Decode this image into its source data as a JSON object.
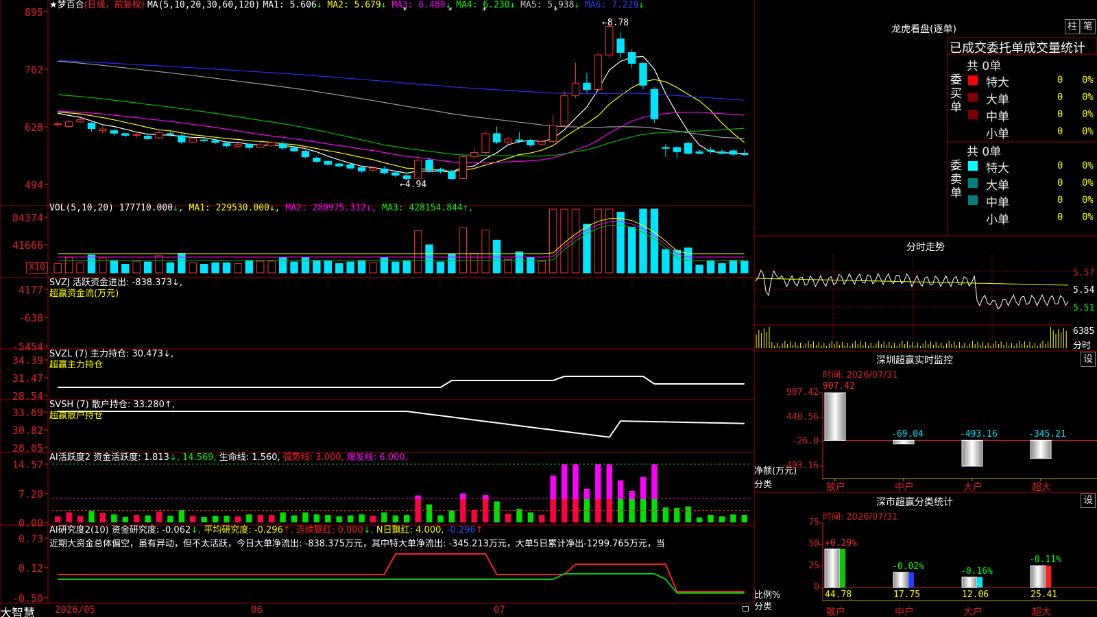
{
  "stock_title": "★梦百合",
  "period": "(日线，前复权)",
  "ma_header": {
    "label": "MA(5,10,20,30,60,120)",
    "items": [
      {
        "name": "MA1:",
        "value": "5.606",
        "arrow": "↓",
        "color": "#ffffff"
      },
      {
        "name": "MA2:",
        "value": "5.679",
        "arrow": "↓",
        "color": "#ffff00"
      },
      {
        "name": "MA3:",
        "value": "6.480",
        "arrow": "↓",
        "color": "#ff00ff"
      },
      {
        "name": "MA4:",
        "value": "6.230",
        "arrow": "↓",
        "color": "#00ff00"
      },
      {
        "name": "MA5:",
        "value": "5.938",
        "arrow": "↓",
        "color": "#c0c0c0"
      },
      {
        "name": "MA6:",
        "value": "7.229",
        "arrow": "↓",
        "color": "#2d43ff"
      }
    ]
  },
  "price_axis": [
    "895",
    "762",
    "628",
    "494"
  ],
  "price_max_label": "←8.78",
  "price_min_label": "←4.94",
  "vol_header": {
    "label": "VOL(5,10,20)",
    "value": "177710.000",
    "arrow": "↓",
    "items": [
      {
        "name": "MA1:",
        "value": "229530.000",
        "arrow": "↓",
        "color": "#ffff00"
      },
      {
        "name": "MA2:",
        "value": "280975.312",
        "arrow": "↓",
        "color": "#ff00ff"
      },
      {
        "name": "MA3:",
        "value": "428154.844",
        "arrow": "↑",
        "color": "#00ff00"
      }
    ]
  },
  "vol_axis": [
    "84374",
    "41666"
  ],
  "vol_unit": "X10",
  "svzj": {
    "line1": "SVZJ  活跃资金进出: -838.373↓,",
    "line2": "超赢资金流(万元)",
    "axis": [
      "4177",
      "-638",
      "-5454"
    ]
  },
  "svzl": {
    "line1": "SVZL (7) 主力持仓: 30.473↓,",
    "line2": "超赢主力持仓",
    "axis": [
      "34.39",
      "31.47",
      "28.54"
    ]
  },
  "svsh": {
    "line1": "SVSH (7) 散户持仓: 33.280↑,",
    "line2": "超赢散户持仓",
    "axis": [
      "33.69",
      "30.82",
      "28.05"
    ]
  },
  "ai1": {
    "items": [
      {
        "t": "AI活跃度2 资金活跃度: 1.813",
        "c": "#ffffff"
      },
      {
        "t": "↓, 14.569,",
        "c": "#00ff00"
      },
      {
        "t": " 生命线: 1.560,",
        "c": "#ffffff"
      },
      {
        "t": " 强势线: 3.000,",
        "c": "#ff2020"
      },
      {
        "t": " 爆发线: 6.000,",
        "c": "#ff00ff"
      }
    ],
    "axis": [
      "14.57",
      "7.20",
      "0.00"
    ]
  },
  "ai2": {
    "items": [
      {
        "t": "AI研究度2(10) 资金研究度: -0.062",
        "c": "#ffffff"
      },
      {
        "t": "↓, ",
        "c": "#00ff00"
      },
      {
        "t": "平均研究度: -0.296",
        "c": "#ffff00"
      },
      {
        "t": "↑, ",
        "c": "#ff2020"
      },
      {
        "t": "连续飘红: 0.000",
        "c": "#ff2020"
      },
      {
        "t": "↓, ",
        "c": "#00ff00"
      },
      {
        "t": "N日飘红: 4.000, ",
        "c": "#ffff00"
      },
      {
        "t": "-0.296",
        "c": "#3050ff"
      },
      {
        "t": "↑",
        "c": "#ff2020"
      }
    ],
    "comment": "近期大资金总体偏空，虽有异动，但不太活跃，今日大单净流出: -838.375万元，其中特大单净流出: -345.213万元，大单5日累计净出-1299.765万元，当",
    "axis": [
      "0.73",
      "0.12",
      "-0.50"
    ]
  },
  "bottom_bar": {
    "brand": "大智慧",
    "dates": [
      "2026/05",
      "06",
      "07"
    ]
  },
  "dragon": {
    "title": "龙虎看盘(逐单)",
    "btn1": "柱",
    "btn2": "笔",
    "header": "已成交委托单成交量统计",
    "buy": {
      "label": "委买单",
      "total": "共 0单",
      "rows": [
        {
          "name": "特大",
          "v": "0",
          "p": "0%",
          "color": "#ff0000"
        },
        {
          "name": "大单",
          "v": "0",
          "p": "0%",
          "color": "#800000"
        },
        {
          "name": "中单",
          "v": "0",
          "p": "0%",
          "color": "#800000"
        },
        {
          "name": "小单",
          "v": "0",
          "p": "0%",
          "color": ""
        }
      ]
    },
    "sell": {
      "label": "委卖单",
      "total": "共 0单",
      "rows": [
        {
          "name": "特大",
          "v": "0",
          "p": "0%",
          "color": "#00ffff"
        },
        {
          "name": "大单",
          "v": "0",
          "p": "0%",
          "color": "#008080"
        },
        {
          "name": "中单",
          "v": "0",
          "p": "0%",
          "color": "#008080"
        },
        {
          "name": "小单",
          "v": "0",
          "p": "0%",
          "color": ""
        }
      ]
    }
  },
  "intraday": {
    "title": "分时走势",
    "axis": [
      "5.57",
      "5.54",
      "5.51"
    ],
    "vol_label": "6385",
    "vol_caption": "分时"
  },
  "monitor": {
    "title": "深圳超赢实时监控",
    "btn": "设",
    "time": "时间: 2026/07/31",
    "axis": [
      "907.42",
      "440.56",
      "-26.0",
      "-493.16"
    ],
    "ylabel": "净额(万元)",
    "xlabel": "分类",
    "cats": [
      {
        "name": "散户",
        "value": "907.42",
        "v": 907.42
      },
      {
        "name": "中户",
        "value": "-69.04",
        "v": -69.04
      },
      {
        "name": "大户",
        "value": "-493.16",
        "v": -493.16
      },
      {
        "name": "超大",
        "value": "-345.21",
        "v": -345.21
      }
    ]
  },
  "classstat": {
    "title": "深市超赢分类统计",
    "btn": "设",
    "time": "时间: 2026/07/31",
    "axis": [
      "75",
      "50",
      "25",
      "0"
    ],
    "ylabel": "比例%",
    "xlabel": "分类",
    "cats": [
      {
        "name": "散户",
        "top": "+0.29%",
        "bottom": "44.78",
        "v": 44.78,
        "color": "#00cc00"
      },
      {
        "name": "中户",
        "top": "-0.02%",
        "bottom": "17.75",
        "v": 17.75,
        "color": "#2040ff"
      },
      {
        "name": "大户",
        "top": "-0.16%",
        "bottom": "12.06",
        "v": 12.06,
        "color": "#00e5ff"
      },
      {
        "name": "超大",
        "top": "-0.11%",
        "bottom": "25.41",
        "v": 25.41,
        "color": "#ff2020"
      }
    ]
  },
  "chart_data": {
    "type": "candlestick",
    "note_series": "daily K-line",
    "candles": [
      [
        6.28,
        6.28,
        6.22,
        6.34
      ],
      [
        6.22,
        6.33,
        6.18,
        6.38
      ],
      [
        6.33,
        6.38,
        6.29,
        6.42
      ],
      [
        6.3,
        6.17,
        6.1,
        6.33
      ],
      [
        6.12,
        6.16,
        6.05,
        6.24
      ],
      [
        6.12,
        6.06,
        6.0,
        6.16
      ],
      [
        6.05,
        6.01,
        5.96,
        6.07
      ],
      [
        6.01,
        6.03,
        5.95,
        6.1
      ],
      [
        5.99,
        5.93,
        5.9,
        6.04
      ],
      [
        5.95,
        6.07,
        5.92,
        6.14
      ],
      [
        6.05,
        6.03,
        5.98,
        6.11
      ],
      [
        6.0,
        5.85,
        5.8,
        6.05
      ],
      [
        5.85,
        5.93,
        5.83,
        5.96
      ],
      [
        5.9,
        5.88,
        5.83,
        5.94
      ],
      [
        5.88,
        5.84,
        5.8,
        5.93
      ],
      [
        5.82,
        5.76,
        5.72,
        5.85
      ],
      [
        5.75,
        5.79,
        5.71,
        5.83
      ],
      [
        5.8,
        5.72,
        5.66,
        5.82
      ],
      [
        5.72,
        5.78,
        5.7,
        5.85
      ],
      [
        5.76,
        5.84,
        5.73,
        5.88
      ],
      [
        5.81,
        5.71,
        5.66,
        5.86
      ],
      [
        5.71,
        5.64,
        5.6,
        5.74
      ],
      [
        5.63,
        5.5,
        5.46,
        5.66
      ],
      [
        5.47,
        5.39,
        5.35,
        5.51
      ],
      [
        5.39,
        5.32,
        5.28,
        5.43
      ],
      [
        5.33,
        5.28,
        5.24,
        5.36
      ],
      [
        5.31,
        5.23,
        5.2,
        5.34
      ],
      [
        5.24,
        5.16,
        5.12,
        5.28
      ],
      [
        5.18,
        5.23,
        5.14,
        5.27
      ],
      [
        5.21,
        5.12,
        5.08,
        5.28
      ],
      [
        5.12,
        5.06,
        5.02,
        5.16
      ],
      [
        5.05,
        4.98,
        4.94,
        5.09
      ],
      [
        4.99,
        5.42,
        4.98,
        5.52
      ],
      [
        5.42,
        5.18,
        5.12,
        5.48
      ],
      [
        5.2,
        5.15,
        5.1,
        5.24
      ],
      [
        5.15,
        4.98,
        4.95,
        5.19
      ],
      [
        4.98,
        5.5,
        4.97,
        5.55
      ],
      [
        5.5,
        5.6,
        5.45,
        5.7
      ],
      [
        5.6,
        6.05,
        5.55,
        6.1
      ],
      [
        6.05,
        5.85,
        5.8,
        6.22
      ],
      [
        5.85,
        5.92,
        5.8,
        5.97
      ],
      [
        5.9,
        5.87,
        5.82,
        6.09
      ],
      [
        5.88,
        5.78,
        5.73,
        5.93
      ],
      [
        5.8,
        5.86,
        5.75,
        5.9
      ],
      [
        5.86,
        6.25,
        5.82,
        6.49
      ],
      [
        6.25,
        6.95,
        6.2,
        7.05
      ],
      [
        6.95,
        7.25,
        6.9,
        7.74
      ],
      [
        7.25,
        7.1,
        7.02,
        7.5
      ],
      [
        7.1,
        7.92,
        7.05,
        7.98
      ],
      [
        7.92,
        8.6,
        7.85,
        8.78
      ],
      [
        8.3,
        7.98,
        7.85,
        8.45
      ],
      [
        7.98,
        7.72,
        7.6,
        8.05
      ],
      [
        7.72,
        7.2,
        7.1,
        7.75
      ],
      [
        7.1,
        6.4,
        6.3,
        7.15
      ],
      [
        5.72,
        5.7,
        5.5,
        5.8
      ],
      [
        5.72,
        5.62,
        5.45,
        5.74
      ],
      [
        5.82,
        5.58,
        5.56,
        5.88
      ],
      [
        5.62,
        5.58,
        5.56,
        5.66
      ],
      [
        5.66,
        5.63,
        5.58,
        5.73
      ],
      [
        5.62,
        5.58,
        5.56,
        5.68
      ],
      [
        5.64,
        5.56,
        5.52,
        5.68
      ],
      [
        5.58,
        5.55,
        5.53,
        5.68
      ]
    ]
  }
}
